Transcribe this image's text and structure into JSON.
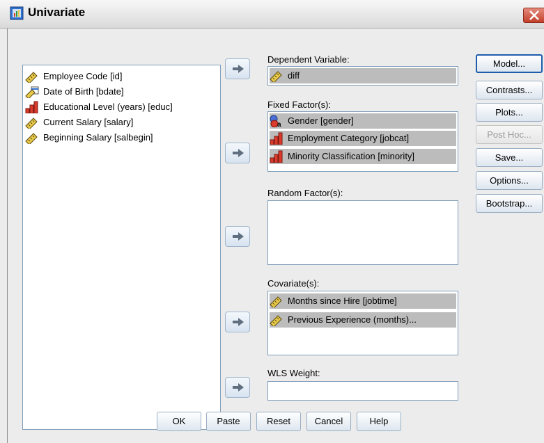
{
  "window": {
    "title": "Univariate"
  },
  "source_variables": [
    {
      "label": "Employee Code [id]",
      "icon": "scale-ruler-icon"
    },
    {
      "label": "Date of Birth [bdate]",
      "icon": "date-scale-icon"
    },
    {
      "label": "Educational Level (years) [educ]",
      "icon": "ordinal-bars-icon"
    },
    {
      "label": "Current Salary [salary]",
      "icon": "scale-ruler-icon"
    },
    {
      "label": "Beginning Salary [salbegin]",
      "icon": "scale-ruler-icon"
    }
  ],
  "dependent": {
    "label": "Dependent Variable:",
    "value": "diff",
    "icon": "scale-ruler-icon"
  },
  "fixed_factors": {
    "label": "Fixed Factor(s):",
    "items": [
      {
        "label": "Gender [gender]",
        "icon": "nominal-icon"
      },
      {
        "label": "Employment Category [jobcat]",
        "icon": "ordinal-bars-icon"
      },
      {
        "label": "Minority Classification [minority]",
        "icon": "ordinal-bars-icon"
      }
    ]
  },
  "random_factors": {
    "label": "Random Factor(s):",
    "items": []
  },
  "covariates": {
    "label": "Covariate(s):",
    "items": [
      {
        "label": "Months since Hire [jobtime]",
        "icon": "scale-ruler-icon"
      },
      {
        "label": "Previous Experience (months)...",
        "icon": "scale-ruler-icon"
      }
    ]
  },
  "wls": {
    "label": "WLS Weight:",
    "value": ""
  },
  "side_buttons": {
    "model": "Model...",
    "contrasts": "Contrasts...",
    "plots": "Plots...",
    "post_hoc": "Post Hoc...",
    "save": "Save...",
    "options": "Options...",
    "bootstrap": "Bootstrap..."
  },
  "bottom_buttons": {
    "ok": "OK",
    "paste": "Paste",
    "reset": "Reset",
    "cancel": "Cancel",
    "help": "Help"
  },
  "colors": {
    "selection": "#bcbcbc",
    "default_button_border": "#1d5caa",
    "listbox_border": "#7f9db9"
  }
}
